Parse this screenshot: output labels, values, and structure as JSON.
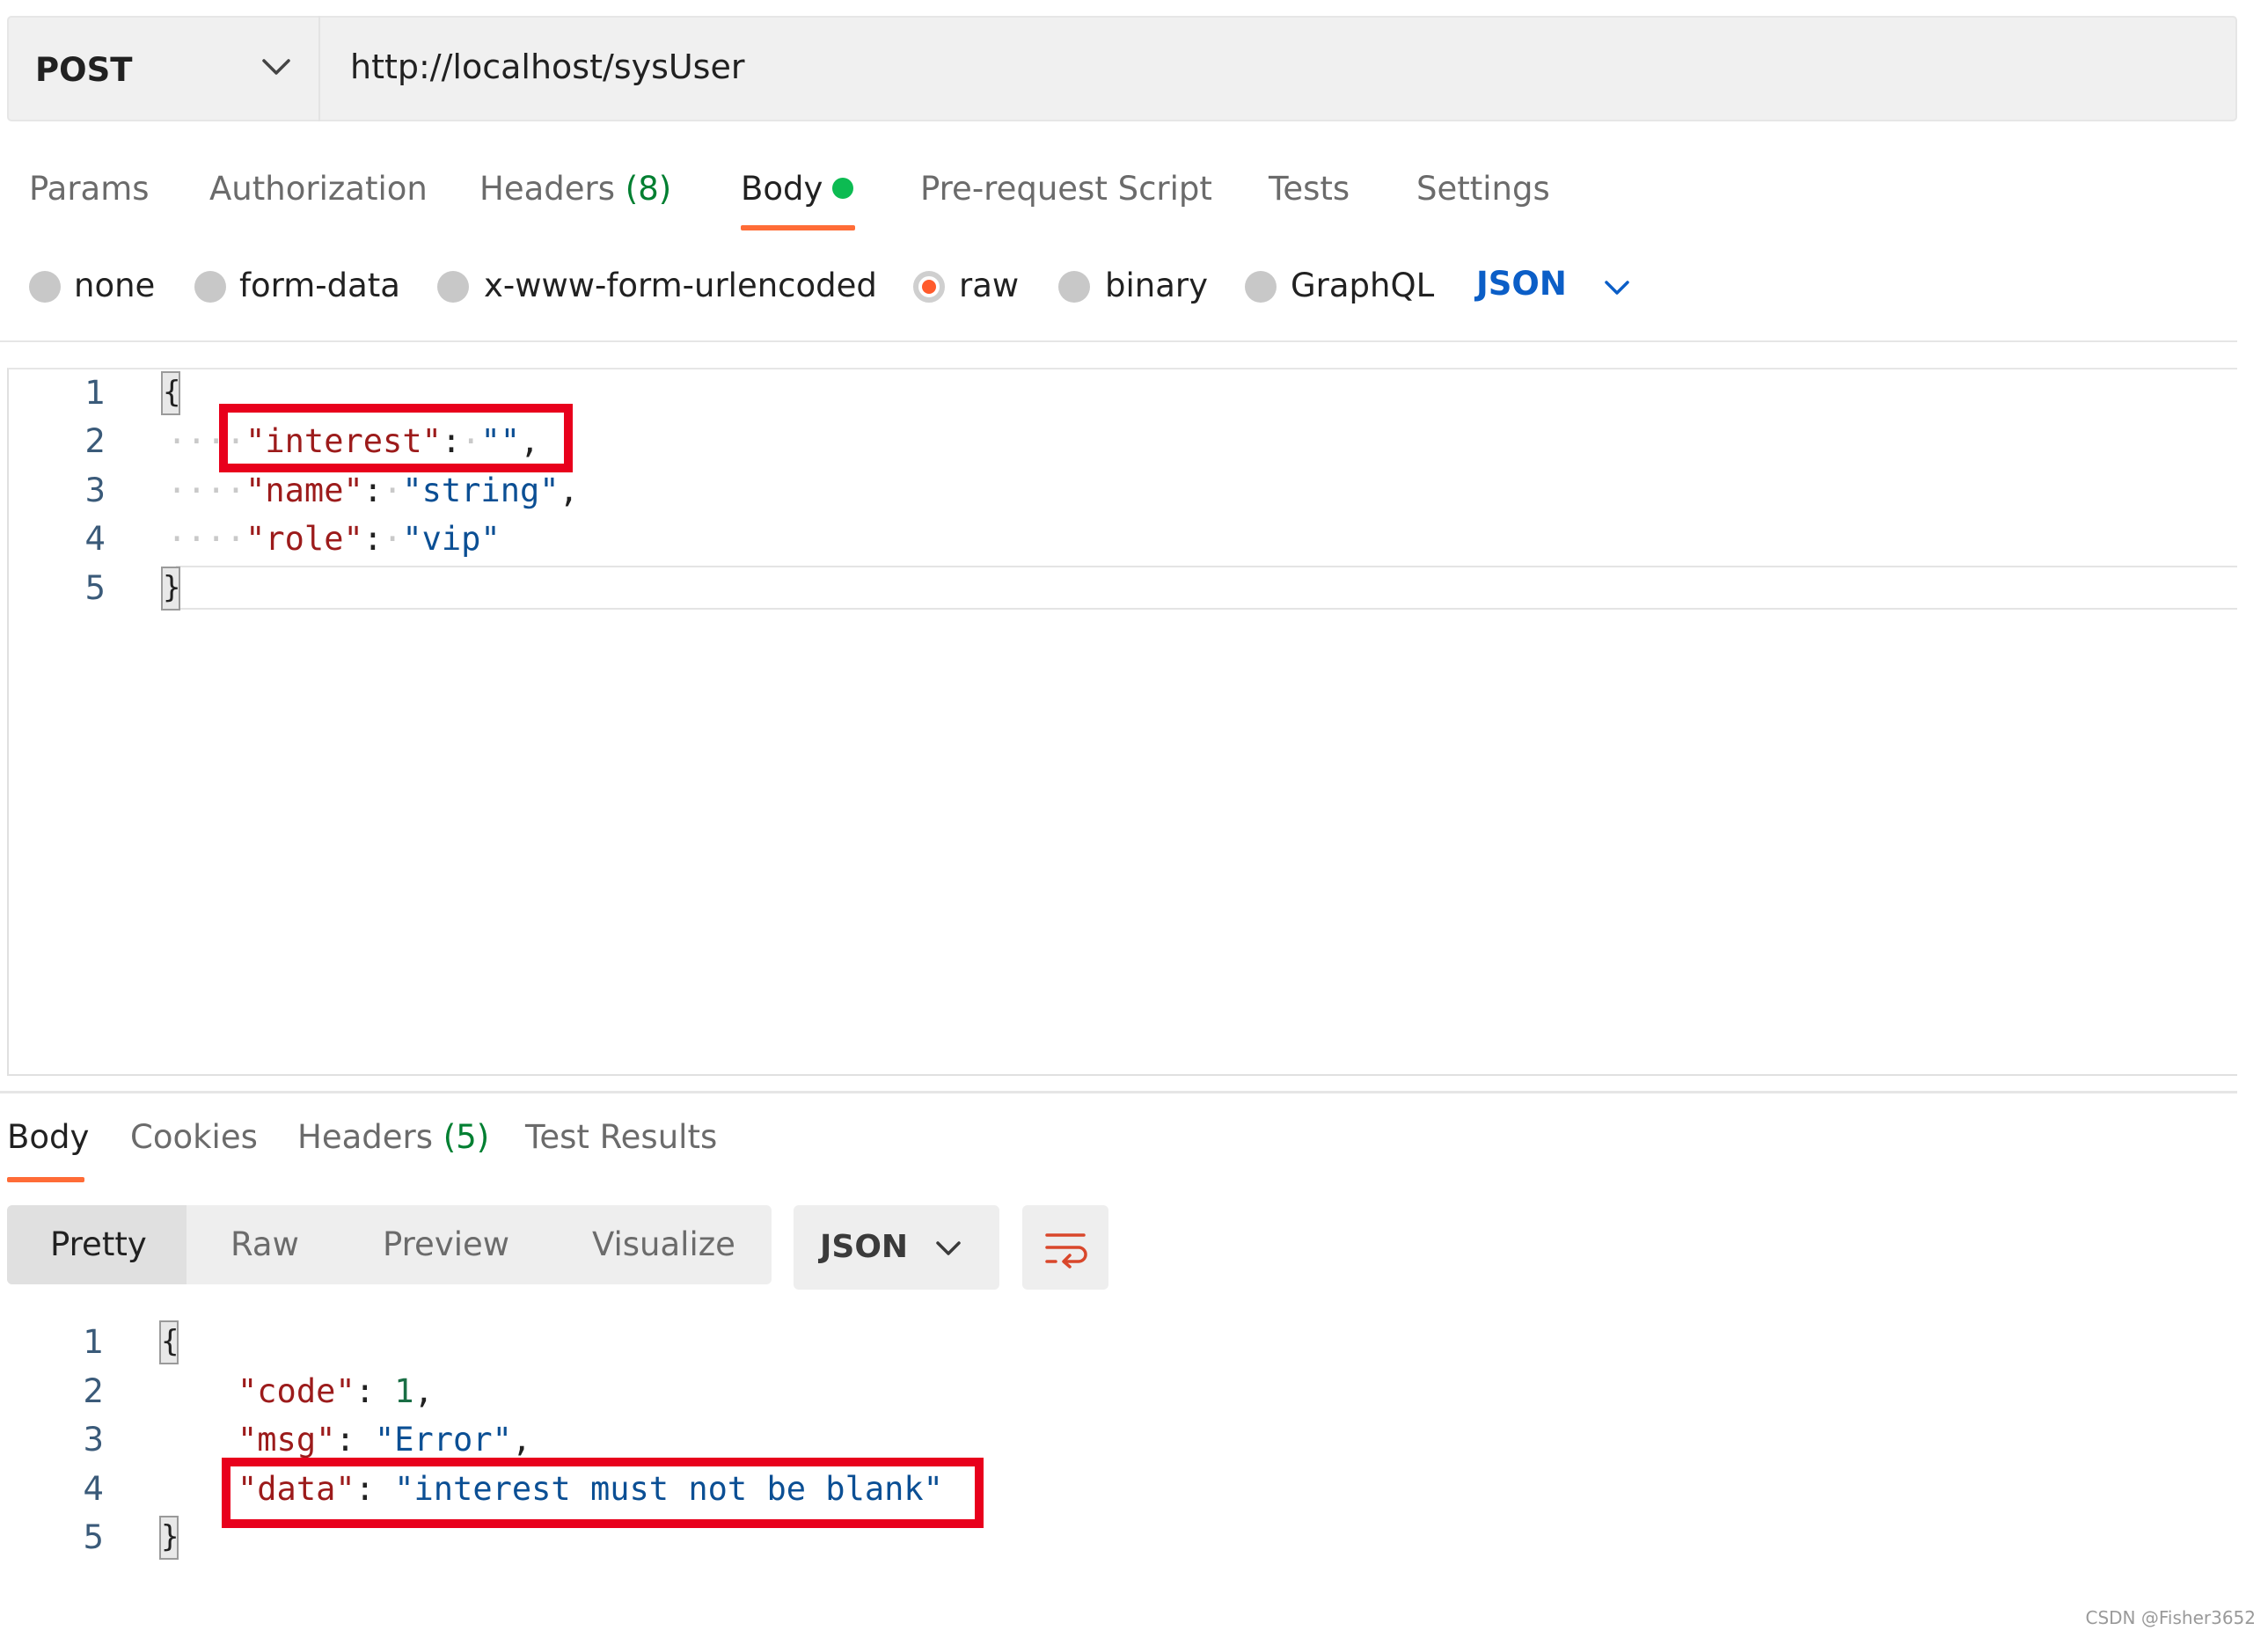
{
  "request": {
    "method": "POST",
    "url": "http://localhost/sysUser",
    "tabs": [
      {
        "label": "Params"
      },
      {
        "label": "Authorization"
      },
      {
        "label": "Headers",
        "count": "(8)"
      },
      {
        "label": "Body",
        "active": true
      },
      {
        "label": "Pre-request Script"
      },
      {
        "label": "Tests"
      },
      {
        "label": "Settings"
      }
    ],
    "body_types": [
      "none",
      "form-data",
      "x-www-form-urlencoded",
      "raw",
      "binary",
      "GraphQL"
    ],
    "body_type_selected": "raw",
    "body_language": "JSON",
    "editor": {
      "line_numbers": [
        "1",
        "2",
        "3",
        "4",
        "5"
      ],
      "open_brace": "{",
      "close_brace": "}",
      "lines": [
        {
          "key": "\"interest\"",
          "value": "\"\"",
          "trail": ","
        },
        {
          "key": "\"name\"",
          "value": "\"string\"",
          "trail": ","
        },
        {
          "key": "\"role\"",
          "value": "\"vip\"",
          "trail": ""
        }
      ]
    }
  },
  "response": {
    "tabs": [
      {
        "label": "Body",
        "active": true
      },
      {
        "label": "Cookies"
      },
      {
        "label": "Headers",
        "count": "(5)"
      },
      {
        "label": "Test Results"
      }
    ],
    "view_modes": [
      "Pretty",
      "Raw",
      "Preview",
      "Visualize"
    ],
    "view_mode_selected": "Pretty",
    "language": "JSON",
    "wrap_icon": "wrap-lines-icon",
    "editor": {
      "line_numbers": [
        "1",
        "2",
        "3",
        "4",
        "5"
      ],
      "open_brace": "{",
      "close_brace": "}",
      "lines": [
        {
          "key": "\"code\"",
          "value": "1",
          "value_type": "number",
          "trail": ","
        },
        {
          "key": "\"msg\"",
          "value": "\"Error\"",
          "value_type": "string",
          "trail": ","
        },
        {
          "key": "\"data\"",
          "value": "\"interest must not be blank\"",
          "value_type": "string",
          "trail": ""
        }
      ]
    }
  },
  "watermark": "CSDN @Fisher3652",
  "colors": {
    "accent": "#ff6c37",
    "annotation_box": "#e8001c",
    "json_key": "#9c1b1b",
    "json_string": "#0b4f94",
    "link_blue": "#0b5ec7",
    "header_count": "#007f31",
    "status_dot": "#0cbb52"
  }
}
